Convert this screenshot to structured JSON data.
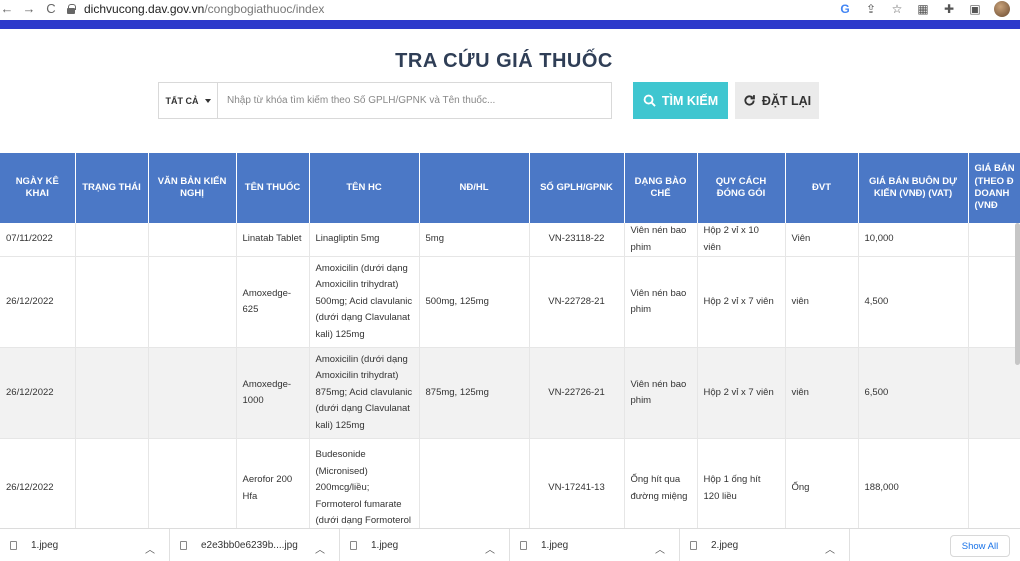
{
  "browser": {
    "url_host": "dichvucong.dav.gov.vn",
    "url_path": "/congbogiathuoc/index",
    "back_icon": "←",
    "forward_icon": "→",
    "reload_icon": "C"
  },
  "page": {
    "title": "TRA CỨU GIÁ THUỐC",
    "accent_color": "#2d3acb",
    "header_color": "#4b78c6"
  },
  "search": {
    "category_label": "TẤT CẢ",
    "placeholder": "Nhập từ khóa tìm kiếm theo Số GPLH/GPNK và Tên thuốc...",
    "search_button": "TÌM KIẾM",
    "reset_button": "ĐẶT LẠI"
  },
  "table": {
    "headers": [
      "NGÀY KÊ KHAI",
      "TRẠNG THÁI",
      "VĂN BẢN KIẾN NGHỊ",
      "TÊN THUỐC",
      "TÊN HC",
      "NĐ/HL",
      "SỐ GPLH/GPNK",
      "DẠNG BÀO CHẾ",
      "QUY CÁCH ĐÓNG GÓI",
      "ĐVT",
      "GIÁ BÁN BUÔN DỰ KIẾN (VNĐ) (VAT)",
      "GIÁ BÁN (THEO Đ DOANH (VNĐ"
    ],
    "rows": [
      {
        "ngay": "07/11/2022",
        "trang_thai": "",
        "van_ban": "",
        "ten_thuoc": "Linatab Tablet",
        "ten_hc": "Linagliptin 5mg",
        "nd_hl": "5mg",
        "so_gplh": "VN-23118-22",
        "dang_bao_che": "Viên nén bao phim",
        "quy_cach": "Hộp 2 vỉ x 10 viên",
        "dvt": "Viên",
        "gia": "10,000"
      },
      {
        "ngay": "26/12/2022",
        "trang_thai": "",
        "van_ban": "",
        "ten_thuoc": "Amoxedge-625",
        "ten_hc": "Amoxicilin (dưới dạng Amoxicilin trihydrat) 500mg; Acid clavulanic (dưới dạng Clavulanat kali) 125mg",
        "nd_hl": "500mg, 125mg",
        "so_gplh": "VN-22728-21",
        "dang_bao_che": "Viên nén bao phim",
        "quy_cach": "Hộp 2 vỉ x 7 viên",
        "dvt": "viên",
        "gia": "4,500"
      },
      {
        "ngay": "26/12/2022",
        "trang_thai": "",
        "van_ban": "",
        "ten_thuoc": "Amoxedge-1000",
        "ten_hc": "Amoxicilin (dưới dạng Amoxicilin trihydrat) 875mg; Acid clavulanic (dưới dạng Clavulanat kali) 125mg",
        "nd_hl": "875mg, 125mg",
        "so_gplh": "VN-22726-21",
        "dang_bao_che": "Viên nén bao phim",
        "quy_cach": "Hộp 2 vỉ x 7 viên",
        "dvt": "viên",
        "gia": "6,500"
      },
      {
        "ngay": "26/12/2022",
        "trang_thai": "",
        "van_ban": "",
        "ten_thuoc": "Aerofor 200 Hfa",
        "ten_hc": "Budesonide (Micronised) 200mcg/liều; Formoterol fumarate (dưới dạng Formoterol",
        "nd_hl": "",
        "so_gplh": "VN-17241-13",
        "dang_bao_che": "Ống hít qua đường miệng",
        "quy_cach": "Hộp 1 ống hít 120 liều",
        "dvt": "Ống",
        "gia": "188,000"
      }
    ]
  },
  "downloads": {
    "items": [
      "1.jpeg",
      "e2e3bb0e6239b....jpg",
      "1.jpeg",
      "1.jpeg",
      "2.jpeg"
    ],
    "show_all": "Show All"
  }
}
